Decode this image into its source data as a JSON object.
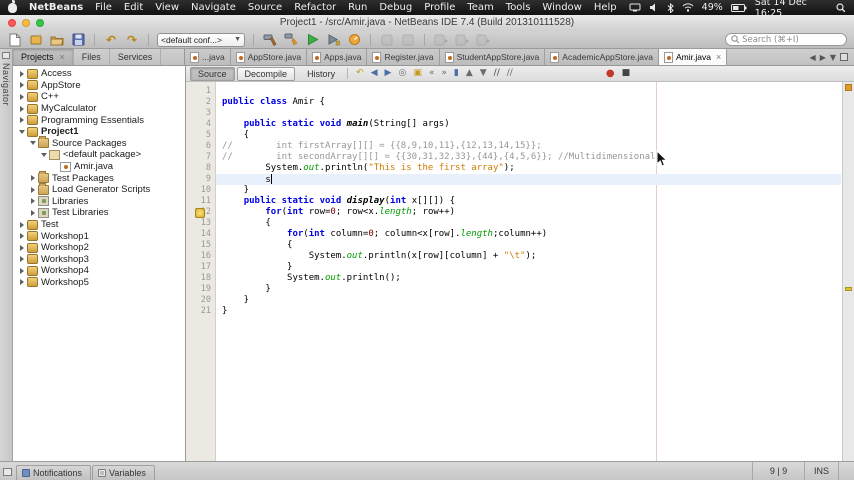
{
  "menubar": {
    "app_menu": "NetBeans",
    "menus": [
      "File",
      "Edit",
      "View",
      "Navigate",
      "Source",
      "Refactor",
      "Run",
      "Debug",
      "Profile",
      "Team",
      "Tools",
      "Window",
      "Help"
    ],
    "battery_pct": "49%",
    "clock": "Sat 14 Dec 16:25"
  },
  "window": {
    "title": "Project1 - /src/Amir.java - NetBeans IDE 7.4 (Build 201310111528)"
  },
  "toolbar": {
    "config_value": "<default conf...>",
    "search_placeholder": "Search (⌘+I)"
  },
  "navigator_strip": {
    "label": "Navigator"
  },
  "panel_tabs": [
    {
      "label": "Projects",
      "active": true
    },
    {
      "label": "Files",
      "active": false
    },
    {
      "label": "Services",
      "active": false
    }
  ],
  "tree": [
    {
      "label": "Access",
      "depth": 0,
      "state": "collapsed",
      "icon": "project"
    },
    {
      "label": "AppStore",
      "depth": 0,
      "state": "collapsed",
      "icon": "project"
    },
    {
      "label": "C++",
      "depth": 0,
      "state": "collapsed",
      "icon": "project"
    },
    {
      "label": "MyCalculator",
      "depth": 0,
      "state": "collapsed",
      "icon": "project"
    },
    {
      "label": "Programming Essentials",
      "depth": 0,
      "state": "collapsed",
      "icon": "project"
    },
    {
      "label": "Project1",
      "depth": 0,
      "state": "expanded",
      "icon": "project",
      "bold": true
    },
    {
      "label": "Source Packages",
      "depth": 1,
      "state": "expanded",
      "icon": "folder"
    },
    {
      "label": "<default package>",
      "depth": 2,
      "state": "expanded",
      "icon": "package"
    },
    {
      "label": "Amir.java",
      "depth": 3,
      "state": "leaf",
      "icon": "java"
    },
    {
      "label": "Test Packages",
      "depth": 1,
      "state": "collapsed",
      "icon": "folder"
    },
    {
      "label": "Load Generator Scripts",
      "depth": 1,
      "state": "collapsed",
      "icon": "folder"
    },
    {
      "label": "Libraries",
      "depth": 1,
      "state": "collapsed",
      "icon": "libraries"
    },
    {
      "label": "Test Libraries",
      "depth": 1,
      "state": "collapsed",
      "icon": "libraries"
    },
    {
      "label": "Test",
      "depth": 0,
      "state": "collapsed",
      "icon": "project"
    },
    {
      "label": "Workshop1",
      "depth": 0,
      "state": "collapsed",
      "icon": "project"
    },
    {
      "label": "Workshop2",
      "depth": 0,
      "state": "collapsed",
      "icon": "project"
    },
    {
      "label": "Workshop3",
      "depth": 0,
      "state": "collapsed",
      "icon": "project"
    },
    {
      "label": "Workshop4",
      "depth": 0,
      "state": "collapsed",
      "icon": "project"
    },
    {
      "label": "Workshop5",
      "depth": 0,
      "state": "collapsed",
      "icon": "project"
    }
  ],
  "editor_tabs": [
    {
      "label": "...java",
      "active": false
    },
    {
      "label": "AppStore.java",
      "active": false
    },
    {
      "label": "Apps.java",
      "active": false
    },
    {
      "label": "Register.java",
      "active": false
    },
    {
      "label": "StudentAppStore.java",
      "active": false
    },
    {
      "label": "AcademicAppStore.java",
      "active": false
    },
    {
      "label": "Amir.java",
      "active": true
    }
  ],
  "editor_toolbar": {
    "source_label": "Source",
    "decompile_label": "Decompile",
    "history_label": "History",
    "icons": [
      "last-edit",
      "back",
      "forward",
      "find-selection",
      "toggle-highlight",
      "previous-bookmark",
      "next-bookmark",
      "toggle-bookmark",
      "previous-occurrence",
      "next-occurrence",
      "comment",
      "uncomment",
      "start-macro",
      "stop-macro"
    ]
  },
  "code": {
    "current_line": 9,
    "warning_line": 12,
    "lines": [
      {
        "n": 1,
        "t": []
      },
      {
        "n": 2,
        "t": [
          [
            "k",
            "public"
          ],
          [
            "p",
            " "
          ],
          [
            "k",
            "class"
          ],
          [
            "p",
            " Amir {"
          ]
        ]
      },
      {
        "n": 3,
        "t": []
      },
      {
        "n": 4,
        "t": [
          [
            "p",
            "    "
          ],
          [
            "k",
            "public"
          ],
          [
            "p",
            " "
          ],
          [
            "k",
            "static"
          ],
          [
            "p",
            " "
          ],
          [
            "k",
            "void"
          ],
          [
            "p",
            " "
          ],
          [
            "m",
            "main"
          ],
          [
            "p",
            "(String[] args)"
          ]
        ]
      },
      {
        "n": 5,
        "t": [
          [
            "p",
            "    {"
          ]
        ]
      },
      {
        "n": 6,
        "t": [
          [
            "c",
            "//        int firstArray[][] = {{8,9,10,11},{12,13,14,15}};"
          ]
        ]
      },
      {
        "n": 7,
        "t": [
          [
            "c",
            "//        int secondArray[][] = {{30,31,32,33},{44},{4,5,6}}; //Multidimensional"
          ]
        ]
      },
      {
        "n": 8,
        "t": [
          [
            "p",
            "        System."
          ],
          [
            "f",
            "out"
          ],
          [
            "p",
            ".println("
          ],
          [
            "s",
            "\"This is the first array\""
          ],
          [
            "p",
            ");"
          ]
        ]
      },
      {
        "n": 9,
        "t": [
          [
            "p",
            "        s"
          ],
          [
            "caret",
            ""
          ]
        ]
      },
      {
        "n": 10,
        "t": [
          [
            "p",
            "    }"
          ]
        ]
      },
      {
        "n": 11,
        "t": [
          [
            "p",
            "    "
          ],
          [
            "k",
            "public"
          ],
          [
            "p",
            " "
          ],
          [
            "k",
            "static"
          ],
          [
            "p",
            " "
          ],
          [
            "k",
            "void"
          ],
          [
            "p",
            " "
          ],
          [
            "m",
            "display"
          ],
          [
            "p",
            "("
          ],
          [
            "k",
            "int"
          ],
          [
            "p",
            " x[][]) {"
          ]
        ]
      },
      {
        "n": 12,
        "t": [
          [
            "p",
            "        "
          ],
          [
            "k",
            "for"
          ],
          [
            "p",
            "("
          ],
          [
            "k",
            "int"
          ],
          [
            "p",
            " row="
          ],
          [
            "num",
            "0"
          ],
          [
            "p",
            "; row<x."
          ],
          [
            "f",
            "length"
          ],
          [
            "p",
            "; row++)"
          ]
        ]
      },
      {
        "n": 13,
        "t": [
          [
            "p",
            "        {"
          ]
        ]
      },
      {
        "n": 14,
        "t": [
          [
            "p",
            "            "
          ],
          [
            "k",
            "for"
          ],
          [
            "p",
            "("
          ],
          [
            "k",
            "int"
          ],
          [
            "p",
            " column="
          ],
          [
            "num",
            "0"
          ],
          [
            "p",
            "; column<x[row]."
          ],
          [
            "f",
            "length"
          ],
          [
            "p",
            ";column++)"
          ]
        ]
      },
      {
        "n": 15,
        "t": [
          [
            "p",
            "            {"
          ]
        ]
      },
      {
        "n": 16,
        "t": [
          [
            "p",
            "                System."
          ],
          [
            "f",
            "out"
          ],
          [
            "p",
            ".println(x[row][column] + "
          ],
          [
            "s",
            "\"\\t\""
          ],
          [
            "p",
            ");"
          ]
        ]
      },
      {
        "n": 17,
        "t": [
          [
            "p",
            "            }"
          ]
        ]
      },
      {
        "n": 18,
        "t": [
          [
            "p",
            "            System."
          ],
          [
            "f",
            "out"
          ],
          [
            "p",
            ".println();"
          ]
        ]
      },
      {
        "n": 19,
        "t": [
          [
            "p",
            "        }"
          ]
        ]
      },
      {
        "n": 20,
        "t": [
          [
            "p",
            "    }"
          ]
        ]
      },
      {
        "n": 21,
        "t": [
          [
            "p",
            "}"
          ]
        ]
      }
    ]
  },
  "statusbar": {
    "tabs": [
      {
        "label": "Notifications",
        "icon": "notifications"
      },
      {
        "label": "Variables",
        "icon": "variables"
      }
    ],
    "caret_position": "9 | 9",
    "insert_mode": "INS"
  },
  "colors": {
    "keyword": "#0000e6",
    "string": "#ce7b00",
    "comment": "#969696",
    "field": "#009b00",
    "run_green": "#3fae49",
    "warning_orange": "#e2992f"
  }
}
